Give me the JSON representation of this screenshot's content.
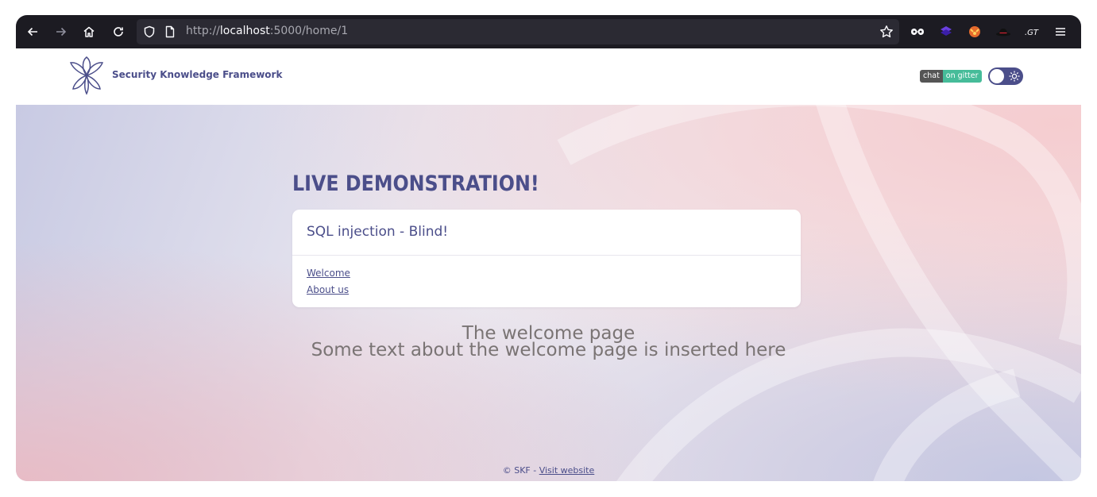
{
  "browser": {
    "url_scheme": "http://",
    "url_host": "localhost",
    "url_rest": ":5000/home/1"
  },
  "site": {
    "brand": "Security Knowledge Framework",
    "badge_left": "chat",
    "badge_right": "on gitter"
  },
  "hero": {
    "title": "LIVE DEMONSTRATION!",
    "card_title": "SQL injection - Blind!",
    "links": [
      "Welcome",
      "About us"
    ]
  },
  "page": {
    "heading": "The welcome page",
    "text": "Some text about the welcome page is inserted here"
  },
  "footer": {
    "prefix": "© SKF - ",
    "link": "Visit website"
  },
  "colors": {
    "accent": "#4b4e8a",
    "toolbar": "#1c1b22",
    "gitter_green": "#46bc99"
  }
}
